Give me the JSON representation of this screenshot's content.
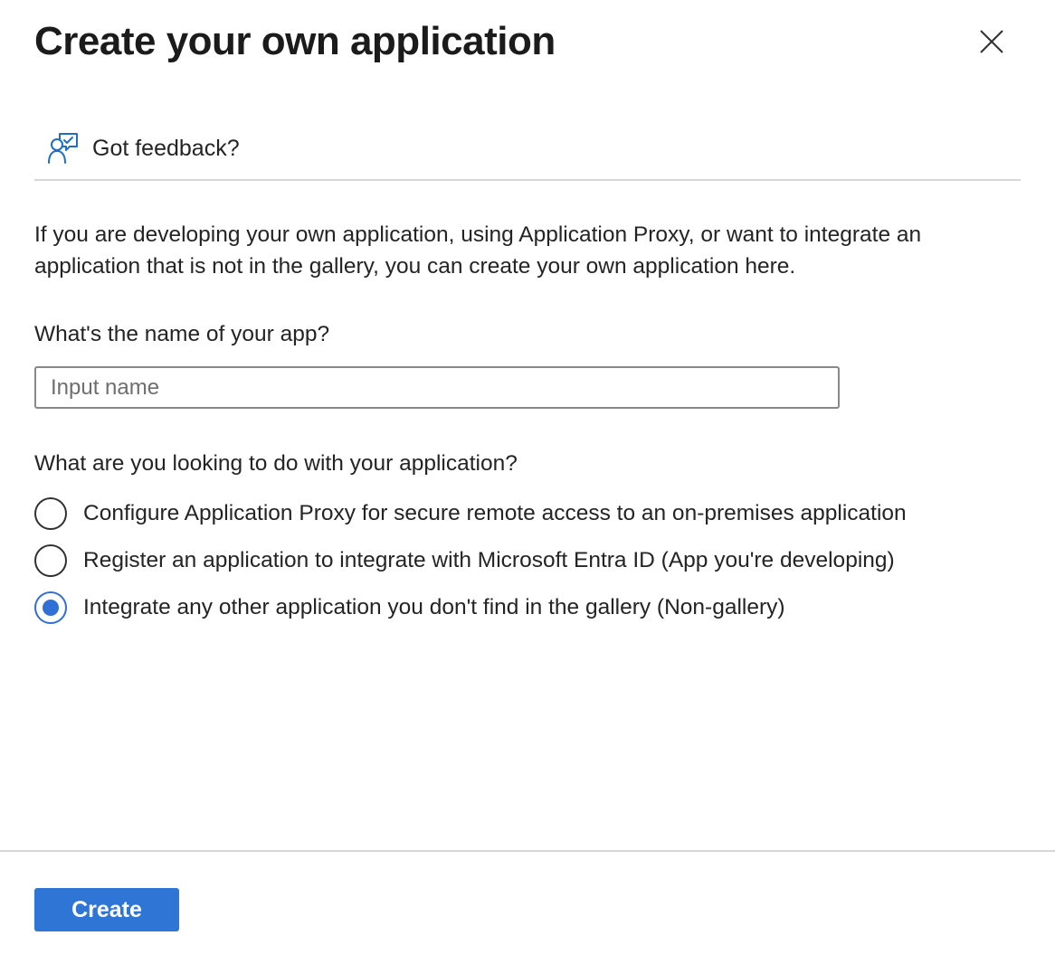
{
  "panel": {
    "title": "Create your own application"
  },
  "feedback": {
    "label": "Got feedback?",
    "icon": "feedback-person-icon"
  },
  "intro": {
    "text": "If you are developing your own application, using Application Proxy, or want to integrate an application that is not in the gallery, you can create your own application here."
  },
  "app_name": {
    "label": "What's the name of your app?",
    "placeholder": "Input name",
    "value": ""
  },
  "purpose": {
    "label": "What are you looking to do with your application?",
    "options": [
      {
        "label": "Configure Application Proxy for secure remote access to an on-premises application",
        "checked": false
      },
      {
        "label": "Register an application to integrate with Microsoft Entra ID (App you're developing)",
        "checked": false
      },
      {
        "label": "Integrate any other application you don't find in the gallery (Non-gallery)",
        "checked": true
      }
    ]
  },
  "footer": {
    "create_label": "Create"
  },
  "colors": {
    "accent": "#2f75d6",
    "radio_selected": "#2f6fd6",
    "feedback_icon": "#1f6fc5"
  }
}
